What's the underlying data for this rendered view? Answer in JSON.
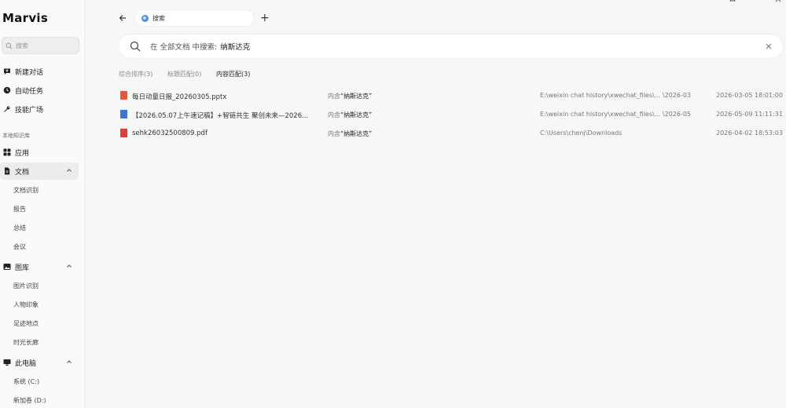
{
  "app": {
    "name": "Marvis"
  },
  "sidebar": {
    "search_placeholder": "搜索",
    "top_items": [
      {
        "label": "新建对话",
        "icon": "chat-plus-icon"
      },
      {
        "label": "自动任务",
        "icon": "clock-icon"
      },
      {
        "label": "技能广场",
        "icon": "wrench-icon"
      }
    ],
    "section_label": "本地知识库",
    "groups": {
      "apps": {
        "label": "应用",
        "icon": "grid-icon"
      },
      "docs": {
        "label": "文档",
        "icon": "document-icon",
        "children": [
          "文档识别",
          "报告",
          "总结",
          "会议"
        ]
      },
      "gallery": {
        "label": "图库",
        "icon": "image-icon",
        "children": [
          "图片识别",
          "人物印象",
          "足迹地点",
          "时光长廊"
        ]
      },
      "computer": {
        "label": "此电脑",
        "icon": "monitor-icon",
        "children": [
          "系统 (C:)",
          "新加卷 (D:)"
        ]
      }
    }
  },
  "topbar": {
    "tab_label": "搜索"
  },
  "query": {
    "prefix": "在 全部文档 中搜索:",
    "term": "纳斯达克"
  },
  "filters": [
    "综合排序(3)",
    "标题匹配(0)",
    "内容匹配(3)"
  ],
  "results": [
    {
      "type": "pptx",
      "icon": "pptx-file-icon",
      "color": "#e8553e",
      "name": "每日动量日报_20260305.pptx",
      "match_prefix": "内含",
      "match_term": "“纳斯达克”",
      "path": "E:\\weixin chat history\\xwechat_files\\... \\2026-03",
      "date": "2026-03-05 18:01:00"
    },
    {
      "type": "docx",
      "icon": "docx-file-icon",
      "color": "#3a73d9",
      "name": "【2026.05.07上午速记稿】+智链共生 聚创未来—2026...",
      "match_prefix": "内含",
      "match_term": "“纳斯达克”",
      "path": "E:\\weixin chat history\\xwechat_files\\... \\2026-05",
      "date": "2026-05-09 11:11:31"
    },
    {
      "type": "pdf",
      "icon": "pdf-file-icon",
      "color": "#e23b3b",
      "name": "sehk26032500809.pdf",
      "match_prefix": "内含",
      "match_term": "“纳斯达克”",
      "path": "C:\\Users\\chenj\\Downloads",
      "date": "2026-04-02 18:53:03"
    }
  ]
}
